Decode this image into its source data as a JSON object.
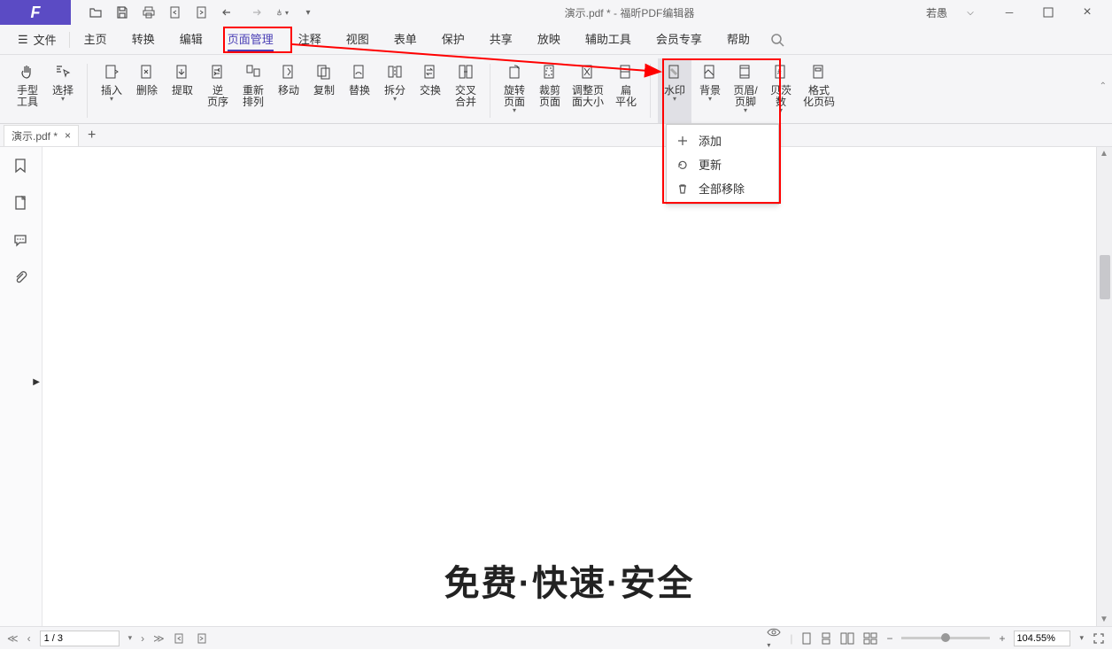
{
  "title": {
    "doc": "演示.pdf *",
    "sep": "-",
    "app": "福昕PDF编辑器"
  },
  "user": "若愚",
  "menu": {
    "file": "文件",
    "items": [
      "主页",
      "转换",
      "编辑",
      "页面管理",
      "注释",
      "视图",
      "表单",
      "保护",
      "共享",
      "放映",
      "辅助工具",
      "会员专享",
      "帮助"
    ],
    "active_index": 3
  },
  "ribbon": {
    "groups": [
      [
        {
          "label": "手型\n工具",
          "icon": "hand",
          "dd": false
        },
        {
          "label": "选择",
          "icon": "select",
          "dd": true
        }
      ],
      [
        {
          "label": "插入",
          "icon": "insert",
          "dd": true
        },
        {
          "label": "删除",
          "icon": "delete",
          "dd": false
        },
        {
          "label": "提取",
          "icon": "extract",
          "dd": false
        },
        {
          "label": "逆\n页序",
          "icon": "reverse",
          "dd": false
        },
        {
          "label": "重新\n排列",
          "icon": "rearrange",
          "dd": false
        },
        {
          "label": "移动",
          "icon": "move",
          "dd": false
        },
        {
          "label": "复制",
          "icon": "copy",
          "dd": false
        },
        {
          "label": "替换",
          "icon": "replace",
          "dd": false
        },
        {
          "label": "拆分",
          "icon": "split",
          "dd": true
        },
        {
          "label": "交换",
          "icon": "swap",
          "dd": false
        },
        {
          "label": "交叉\n合并",
          "icon": "merge",
          "dd": false
        }
      ],
      [
        {
          "label": "旋转\n页面",
          "icon": "rotate",
          "dd": true
        },
        {
          "label": "裁剪\n页面",
          "icon": "crop",
          "dd": false
        },
        {
          "label": "调整页\n面大小",
          "icon": "resize",
          "dd": false
        },
        {
          "label": "扁\n平化",
          "icon": "flatten",
          "dd": false
        }
      ],
      [
        {
          "label": "水印",
          "icon": "watermark",
          "dd": true,
          "active": true
        },
        {
          "label": "背景",
          "icon": "background",
          "dd": true
        },
        {
          "label": "页眉/\n页脚",
          "icon": "headerfooter",
          "dd": true
        },
        {
          "label": "贝茨\n数",
          "icon": "bates",
          "dd": true
        },
        {
          "label": "格式\n化页码",
          "icon": "format",
          "dd": false
        }
      ]
    ]
  },
  "dropdown": {
    "items": [
      {
        "icon": "plus",
        "label": "添加"
      },
      {
        "icon": "refresh",
        "label": "更新"
      },
      {
        "icon": "trash",
        "label": "全部移除"
      }
    ]
  },
  "tab": {
    "name": "演示.pdf *"
  },
  "page_content": "免费·快速·安全",
  "status": {
    "page": "1 / 3",
    "zoom": "104.55%"
  }
}
